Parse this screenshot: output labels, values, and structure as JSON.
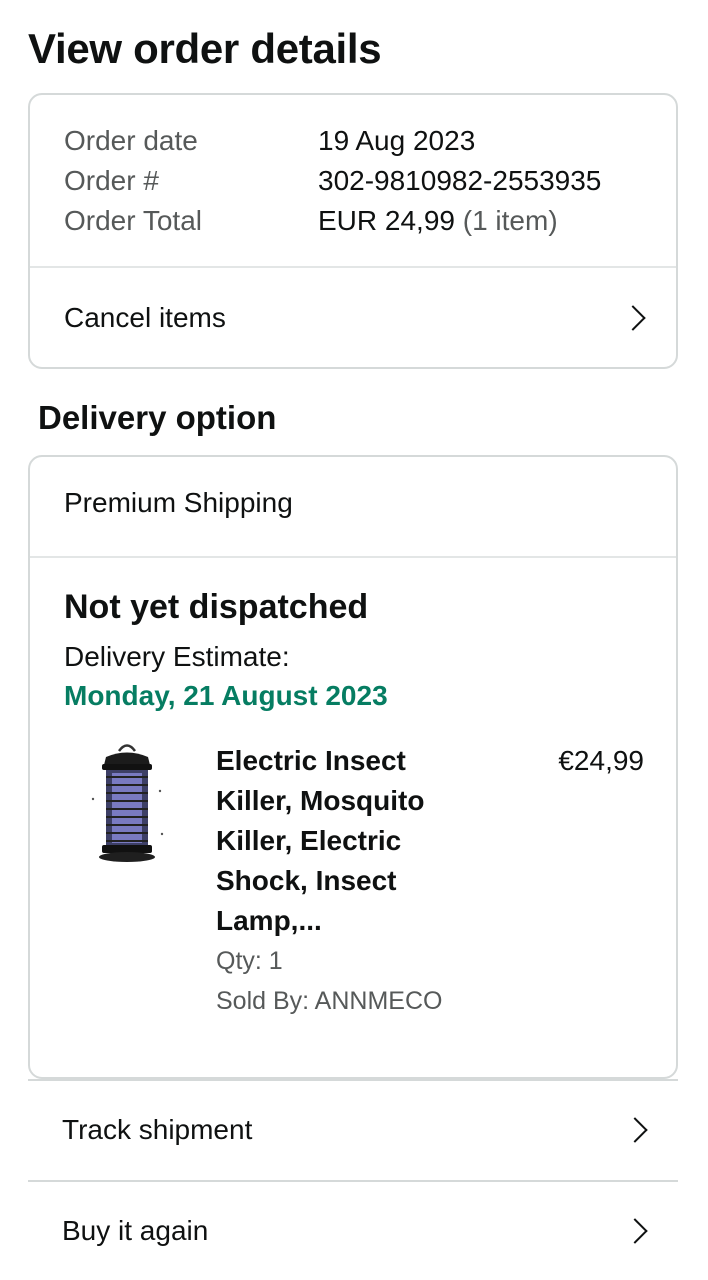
{
  "page": {
    "title": "View order details"
  },
  "summary": {
    "order_date_label": "Order date",
    "order_date_value": "19 Aug 2023",
    "order_number_label": "Order #",
    "order_number_value": "302-9810982-2553935",
    "order_total_label": "Order Total",
    "order_total_value": "EUR 24,99",
    "order_total_items": "(1 item)",
    "cancel_label": "Cancel items"
  },
  "delivery": {
    "heading": "Delivery option",
    "shipping_method": "Premium Shipping",
    "status": "Not yet dispatched",
    "estimate_label": "Delivery Estimate:",
    "estimate_date": "Monday, 21 August 2023",
    "estimate_color": "#067d62"
  },
  "item": {
    "title": "Electric Insect Killer, Mosquito Killer, Electric Shock, Insect Lamp,...",
    "price": "€24,99",
    "qty": "Qty: 1",
    "sold_by": "Sold By: ANNMECO",
    "image_icon": "insect-killer-lamp-image"
  },
  "actions": {
    "track_label": "Track shipment",
    "buy_again_label": "Buy it again"
  }
}
